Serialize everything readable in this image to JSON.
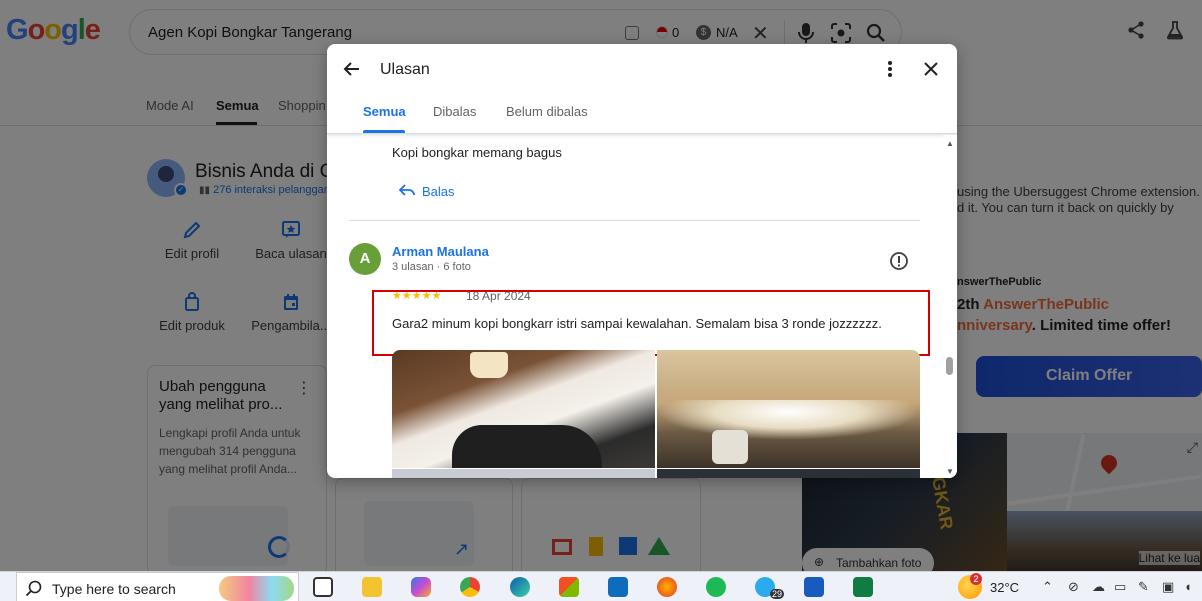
{
  "google": {
    "logo_letters": [
      "G",
      "o",
      "o",
      "g",
      "l",
      "e"
    ],
    "query": "Agen Kopi Bongkar Tangerang",
    "ext_count": "0",
    "ext_na": "N/A"
  },
  "tabs": {
    "mode_ai": "Mode AI",
    "semua": "Semua",
    "shopping": "Shoppin"
  },
  "business": {
    "title": "Bisnis Anda di G",
    "subtitle": "276 interaksi pelanggan",
    "actions": [
      "Edit profil",
      "Baca ulasan",
      "Edit produk",
      "Pengambila..."
    ]
  },
  "card": {
    "title": "Ubah pengguna yang melihat pro...",
    "description": "Lengkapi profil Anda untuk mengubah 314 pengguna yang melihat profil Anda..."
  },
  "sidebar_right": {
    "ext_line1": "using the Ubersuggest Chrome extension.",
    "ext_line2": "d it. You can turn it back on quickly by",
    "atp_brand": "nswerThePublic",
    "atp_line1_a": "2th ",
    "atp_line1_b": "AnswerThePublic",
    "atp_line2_a": "nniversary",
    "atp_line2_b": ". Limited time offer!",
    "claim": "Claim Offer",
    "add_photo": "Tambahkan foto",
    "map_link": "Lihat ke lua",
    "photo_sign": "BONGKAR"
  },
  "dialog": {
    "title": "Ulasan",
    "tabs": [
      "Semua",
      "Dibalas",
      "Belum dibalas"
    ],
    "prev_review_text": "Kopi bongkar memang bagus",
    "reply_label": "Balas",
    "review": {
      "avatar_letter": "A",
      "author": "Arman Maulana",
      "meta": "3 ulasan · 6 foto",
      "stars": "★★★★★",
      "rating": 5,
      "date": "18 Apr 2024",
      "text": "Gara2 minum kopi bongkarr istri sampai kewalahan. Semalam bisa 3 ronde jozzzzzz."
    }
  },
  "taskbar": {
    "search_placeholder": "Type here to search",
    "weather_badge": "2",
    "temperature": "32°C",
    "telegram_badge": "29"
  },
  "colors": {
    "accent": "#1a73e8",
    "highlight_box": "#d50000",
    "star": "#fbbc04",
    "avatar": "#689f38"
  }
}
